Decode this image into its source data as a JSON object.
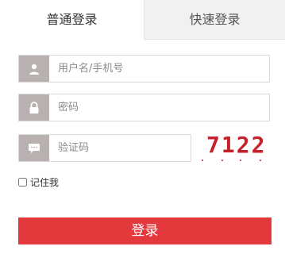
{
  "tabs": {
    "normal_login": "普通登录",
    "quick_login": "快速登录"
  },
  "form": {
    "username_placeholder": "用户名/手机号",
    "password_placeholder": "密码",
    "captcha_placeholder": "验证码",
    "captcha_code": "7122",
    "remember_label": "记住我",
    "login_button": "登录"
  },
  "icons": {
    "username": "user-icon",
    "password": "lock-icon",
    "captcha": "chat-bubble-icon"
  },
  "colors": {
    "accent": "#e4393c",
    "icon_bg": "#b9b0b0",
    "captcha_text": "#c8202a",
    "inactive_tab": "#f1f1f1"
  }
}
